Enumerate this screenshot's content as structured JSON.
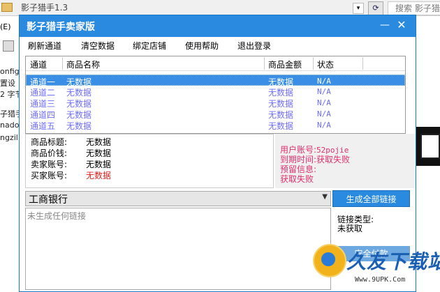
{
  "background": {
    "window_title": "影子猎手1.3",
    "search_placeholder": "搜索 影子猎",
    "menu_fragment": "(E)",
    "side_texts": [
      "onfig",
      "置设",
      "2 字节",
      "子猎手",
      "nado",
      "ngzil"
    ]
  },
  "app": {
    "title": "影子猎手卖家版",
    "min_glyph": "—",
    "close_glyph": "✕",
    "menu": [
      "刷新通道",
      "清空数据",
      "绑定店铺",
      "使用帮助",
      "退出登录"
    ],
    "table": {
      "headers": [
        "通道",
        "商品名称",
        "商品金额",
        "状态"
      ],
      "rows": [
        [
          "通道一",
          "无数据",
          "无数据",
          "N/A"
        ],
        [
          "通道二",
          "无数据",
          "无数据",
          "N/A"
        ],
        [
          "通道三",
          "无数据",
          "无数据",
          "N/A"
        ],
        [
          "通道四",
          "无数据",
          "无数据",
          "N/A"
        ],
        [
          "通道五",
          "无数据",
          "无数据",
          "N/A"
        ]
      ],
      "selected_row": 0
    },
    "product": {
      "title_label": "商品标题:",
      "title_value": "无数据",
      "price_label": "商品价钱:",
      "price_value": "无数据",
      "seller_label": "卖家账号:",
      "seller_value": "无数据",
      "buyer_label": "买家账号:",
      "buyer_value": "无数据"
    },
    "user": {
      "account_label": "用户账号:",
      "account_value": "52pojie",
      "expire_label": "到期时间:",
      "expire_value": "获取失败",
      "reserve_label": "预留信息:",
      "reserve_value": "获取失败"
    },
    "bank": "工商银行",
    "generate_button": "生成全部链接",
    "links_placeholder": "未生成任何链接",
    "link_type_label": "链接类型:",
    "link_type_value": "未获取",
    "pay_button": "安全付款"
  },
  "watermark": {
    "title": "久友下载站",
    "url": "Www.9UPK.Com"
  },
  "colors": {
    "titlebar": "#2a8ae0",
    "selected_row": "#3a8ee6",
    "row_text": "#6e6eff",
    "user_info": "#e0306a",
    "error_value": "#e02020"
  }
}
